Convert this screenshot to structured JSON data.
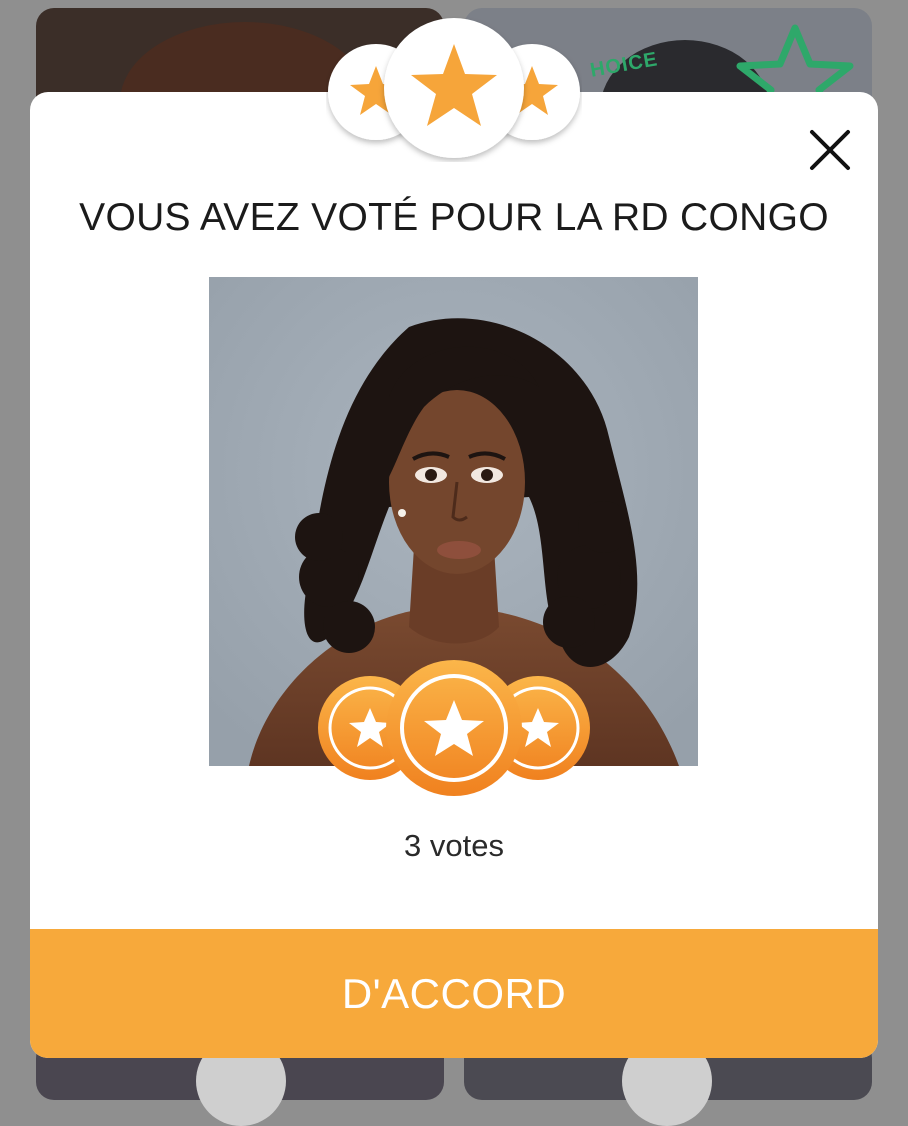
{
  "background": {
    "badge_text": "HOICE"
  },
  "modal": {
    "title": "VOUS AVEZ VOTÉ POUR LA RD CONGO",
    "votes_text": "3 votes",
    "ok_label": "D'ACCORD",
    "close_icon": "close-icon"
  },
  "colors": {
    "accent": "#f7a93b",
    "coin_orange": "#f59a30",
    "star_gold": "#f6a53a",
    "choice_green": "#2ea86a"
  }
}
